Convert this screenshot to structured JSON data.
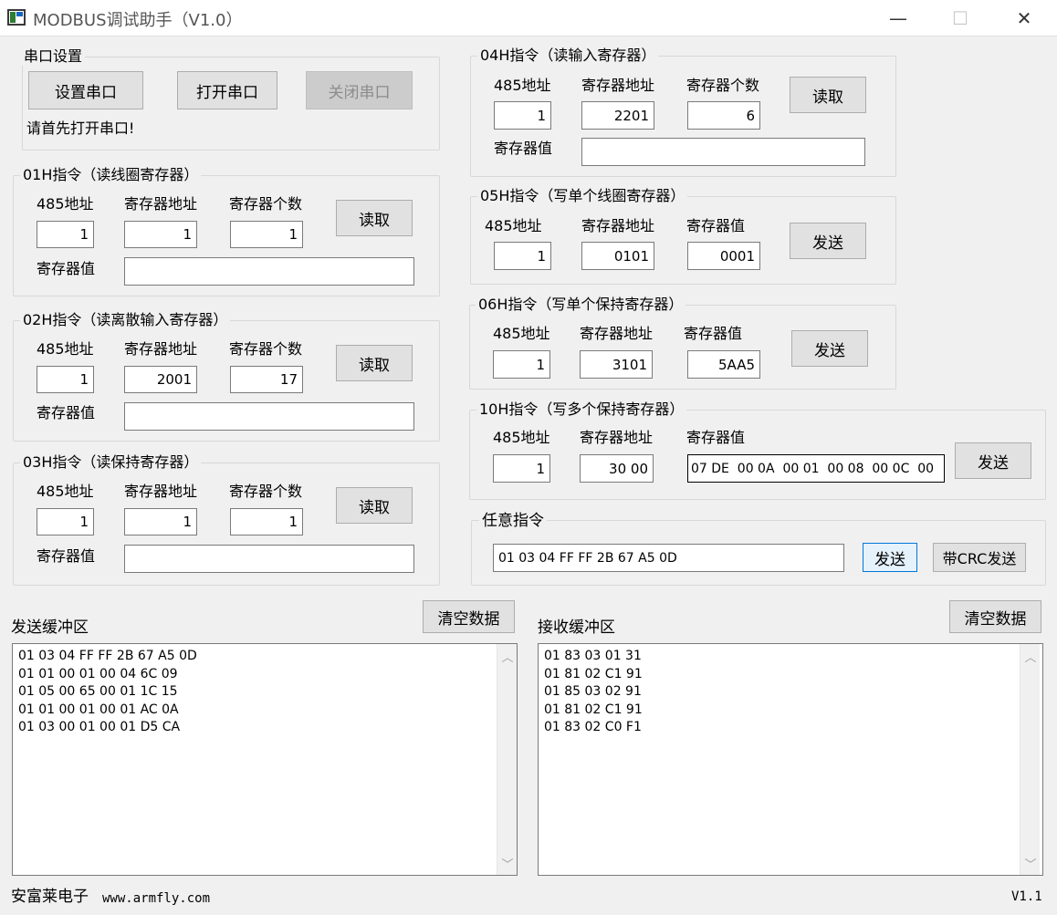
{
  "window": {
    "title": "MODBUS调试助手（V1.0）",
    "minimize_glyph": "—",
    "maximize_glyph": "☐",
    "close_glyph": "✕"
  },
  "serial": {
    "legend": "串口设置",
    "setup_button": "设置串口",
    "open_button": "打开串口",
    "close_button": "关闭串口",
    "status": "请首先打开串口!"
  },
  "labels": {
    "addr485": "485地址",
    "reg_addr": "寄存器地址",
    "reg_count": "寄存器个数",
    "reg_value": "寄存器值",
    "read": "读取",
    "send": "发送"
  },
  "cmd01": {
    "legend": "01H指令（读线圈寄存器）",
    "addr485": "1",
    "reg_addr": "1",
    "reg_count": "1",
    "value": ""
  },
  "cmd02": {
    "legend": "02H指令（读离散输入寄存器）",
    "addr485": "1",
    "reg_addr": "2001",
    "reg_count": "17",
    "value": ""
  },
  "cmd03": {
    "legend": "03H指令（读保持寄存器）",
    "addr485": "1",
    "reg_addr": "1",
    "reg_count": "1",
    "value": ""
  },
  "cmd04": {
    "legend": "04H指令（读输入寄存器）",
    "addr485": "1",
    "reg_addr": "2201",
    "reg_count": "6",
    "value": ""
  },
  "cmd05": {
    "legend": "05H指令（写单个线圈寄存器）",
    "addr485": "1",
    "reg_addr": "0101",
    "reg_value": "0001"
  },
  "cmd06": {
    "legend": "06H指令（写单个保持寄存器）",
    "addr485": "1",
    "reg_addr": "3101",
    "reg_value": "5AA5"
  },
  "cmd10": {
    "legend": "10H指令（写多个保持寄存器）",
    "addr485": "1",
    "reg_addr": "30 00",
    "reg_value": "07 DE  00 0A  00 01  00 08  00 0C  00"
  },
  "any": {
    "legend": "任意指令",
    "value": "01 03 04 FF FF 2B 67 A5 0D",
    "send_button": "发送",
    "crc_send_button": "带CRC发送"
  },
  "send_buffer": {
    "label": "发送缓冲区",
    "clear_button": "清空数据",
    "content": "01 03 04 FF FF 2B 67 A5 0D\n01 01 00 01 00 04 6C 09\n01 05 00 65 00 01 1C 15\n01 01 00 01 00 01 AC 0A\n01 03 00 01 00 01 D5 CA"
  },
  "recv_buffer": {
    "label": "接收缓冲区",
    "clear_button": "清空数据",
    "content": "01 83 03 01 31\n01 81 02 C1 91\n01 85 03 02 91\n01 81 02 C1 91\n01 83 02 C0 F1"
  },
  "footer": {
    "company": "安富莱电子",
    "url": "www.armfly.com",
    "version": "V1.1"
  }
}
